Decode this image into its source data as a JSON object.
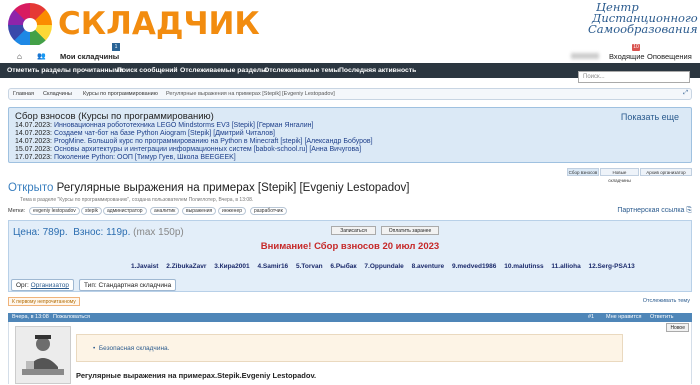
{
  "header": {
    "logo_text": "СКЛАДЧИК",
    "school_line1": "Центр",
    "school_line2": "Дистанционного",
    "school_line3": "Самообразования"
  },
  "nav": {
    "my_skladchiny": "Мои складчины",
    "my_badge": "1",
    "incoming": "Входящие",
    "alerts": "Оповещения",
    "alerts_badge": "10"
  },
  "menu": {
    "items": [
      "Отметить разделы прочитанными",
      "Поиск сообщений",
      "Отслеживаемые разделы",
      "Отслеживаемые темы",
      "Последняя активность"
    ],
    "search_placeholder": "Поиск..."
  },
  "breadcrumb": [
    "Главная",
    "Складчины",
    "Курсы по программированию",
    "Регулярные выражения на примерах [Stepik] [Evgeniy Lestopadov]"
  ],
  "collections": {
    "title": "Сбор взносов (Курсы по программированию)",
    "more": "Показать еще",
    "rows": [
      {
        "date": "14.07.2023:",
        "text": "Инновационная робототехника LEGO Mindstorms EV3 [Stepik] [Герман Янгалин]"
      },
      {
        "date": "14.07.2023:",
        "text": "Создаем чат-бот на базе Python Aiogram [Stepik] [Дмитрий Читалов]"
      },
      {
        "date": "14.07.2023:",
        "text": "ProgMine. Большой курс по программированию на Python в Minecraft [stepik] [Александр Бобуров]"
      },
      {
        "date": "15.07.2023:",
        "text": "Основы архитектуры и интеграции информационных систем [babok-school.ru] [Анна Вичугова]"
      },
      {
        "date": "17.07.2023:",
        "text": "Поколение Python: ООП [Тимур Гуев, Школа BEEGEEK]"
      }
    ],
    "tabs": [
      "Сбор взносов",
      "Новые складчины",
      "Архив организатор"
    ]
  },
  "thread": {
    "prefix": "Открыто",
    "title": "Регулярные выражения на примерах [Stepik] [Evgeniy Lestopadov]",
    "subline": "Тема в разделе \"Курсы по программированию\", создана пользователем Полиглотер, Вчера, в 13:08.",
    "tags_label": "Метки:",
    "tags": [
      "evgeniy lestopadov",
      "stepik",
      "администратор",
      "аналитик",
      "выражения",
      "инженер",
      "разработчик"
    ],
    "share": "Партнерская ссылка"
  },
  "price": {
    "price_label": "Цена: 789р.",
    "fee_label": "Взнос: 119р.",
    "fee_extra": "(max 150р)",
    "join_button": "Записаться",
    "pay_button": "Оплатить заранее",
    "alert": "Внимание! Сбор взносов 20 июл 2023",
    "participants": [
      "1.Javaist",
      "2.ZibukaZavr",
      "3.Кира2001",
      "4.Samir16",
      "5.Torvan",
      "6.Рыбак",
      "7.Oppundale",
      "8.aventure",
      "9.medved1986",
      "10.malutinss",
      "11.allioha",
      "12.Serg-PSA13"
    ],
    "org_label": "Орг:",
    "org_value": "Организатор",
    "type_label": "Тип:",
    "type_value": "Стандартная складчина"
  },
  "misc": {
    "unread": "К первому непрочитанному",
    "follow": "Отслеживать тему"
  },
  "post": {
    "time": "Вчера, в 13:08",
    "complain": "Пожаловаться",
    "number": "#1",
    "like": "Мне нравится",
    "reply": "Ответить",
    "new_badge": "Новое",
    "quote_item": "Безопасная складчина.",
    "title": "Регулярные выражения на примерах.Stepik.Evgeniy Lestopadov."
  },
  "colors": {
    "accent": "#2b5b8e",
    "bar": "#2b3640",
    "alert": "#c62828",
    "logo": "#f28c0f"
  }
}
